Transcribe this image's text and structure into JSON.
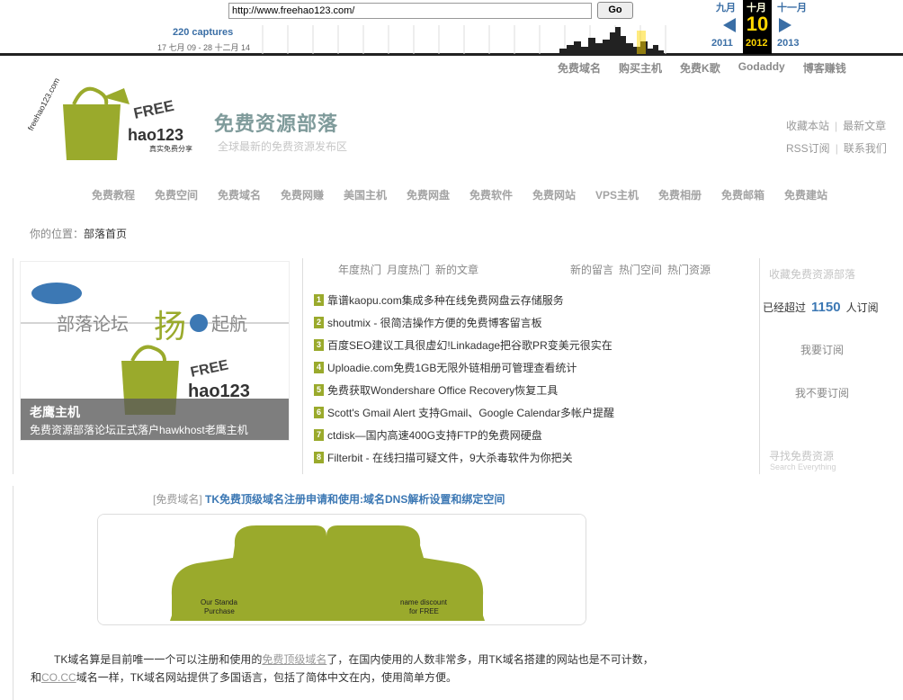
{
  "wayback": {
    "url": "http://www.freehao123.com/",
    "go_label": "Go",
    "captures": "220 captures",
    "range": "17 七月 09 - 28 十二月 14",
    "prev_month": "九月",
    "cur_month": "十月",
    "next_month": "十一月",
    "day": "10",
    "prev_year": "2011",
    "cur_year": "2012",
    "next_year": "2013"
  },
  "toplinks": [
    "免费域名",
    "购买主机",
    "免费K歌",
    "Godaddy",
    "博客赚钱"
  ],
  "logo": {
    "text_arc": "freehao123.com",
    "brand_free": "FREE",
    "brand_hao": "hao123",
    "slogan": "真实免费分享"
  },
  "site": {
    "title": "免费资源部落",
    "subtitle": "全球最新的免费资源发布区"
  },
  "header_links": {
    "bookmark": "收藏本站",
    "latest": "最新文章",
    "rss": "RSS订阅",
    "contact": "联系我们",
    "sep": "|"
  },
  "nav": [
    "免费教程",
    "免费空间",
    "免费域名",
    "免费网赚",
    "美国主机",
    "免费网盘",
    "免费软件",
    "免费网站",
    "VPS主机",
    "免费相册",
    "免费邮箱",
    "免费建站"
  ],
  "breadcrumb": {
    "label": "你的位置：",
    "current": "部落首页"
  },
  "slide": {
    "banner": "部落论坛",
    "banner_big": "扬",
    "banner_end": "起航",
    "caption_title": "老鹰主机",
    "caption_text": "免费资源部落论坛正式落户hawkhost老鹰主机"
  },
  "tabs_left": [
    "年度热门",
    "月度热门",
    "新的文章"
  ],
  "tabs_right": [
    "新的留言",
    "热门空间",
    "热门资源"
  ],
  "news": [
    {
      "num": "1",
      "title": "靠谱kaopu.com集成多种在线免费网盘云存储服务"
    },
    {
      "num": "2",
      "title": "shoutmix - 很简洁操作方便的免费博客留言板"
    },
    {
      "num": "3",
      "title": "百度SEO建议工具很虚幻!Linkadage把谷歌PR变美元很实在"
    },
    {
      "num": "4",
      "title": "Uploadie.com免费1GB无限外链相册可管理查看统计"
    },
    {
      "num": "5",
      "title": "免费获取Wondershare Office Recovery恢复工具"
    },
    {
      "num": "6",
      "title": "Scott's Gmail Alert 支持Gmail、Google Calendar多帐户提醒"
    },
    {
      "num": "7",
      "title": "ctdisk—国内高速400G支持FTP的免费网硬盘"
    },
    {
      "num": "8",
      "title": "Filterbit - 在线扫描可疑文件，9大杀毒软件为你把关"
    }
  ],
  "right_col": {
    "title": "收藏免费资源部落",
    "count_prefix": "已经超过",
    "count": "1150",
    "count_suffix": "人订阅",
    "subscribe": "我要订阅",
    "unsubscribe": "我不要订阅",
    "search_title": "寻找免费资源",
    "search_en": "Search Everything"
  },
  "post": {
    "category": "[免费域名]",
    "title": "TK免费顶级域名注册申请和使用:域名DNS解析设置和绑定空间",
    "image_text1": "Our Standa",
    "image_text2": "name discount",
    "image_text3": "Purchase",
    "image_text4": "for FREE",
    "p1_a": "TK域名算是目前唯一一个可以注册和使用的",
    "p1_link": "免费顶级域名",
    "p1_b": "了，在国内使用的人数非常多，用TK域名搭建的网站也是不可计数，",
    "p2_a": "和",
    "p2_link": "CO.CC",
    "p2_b": "域名一样，TK域名网站提供了多国语言，包括了简体中文在内，使用简单方便。"
  },
  "colors": {
    "accent_green": "#9aaa2c",
    "link_blue": "#3c78b4",
    "wayback_gold": "#ffd700"
  }
}
